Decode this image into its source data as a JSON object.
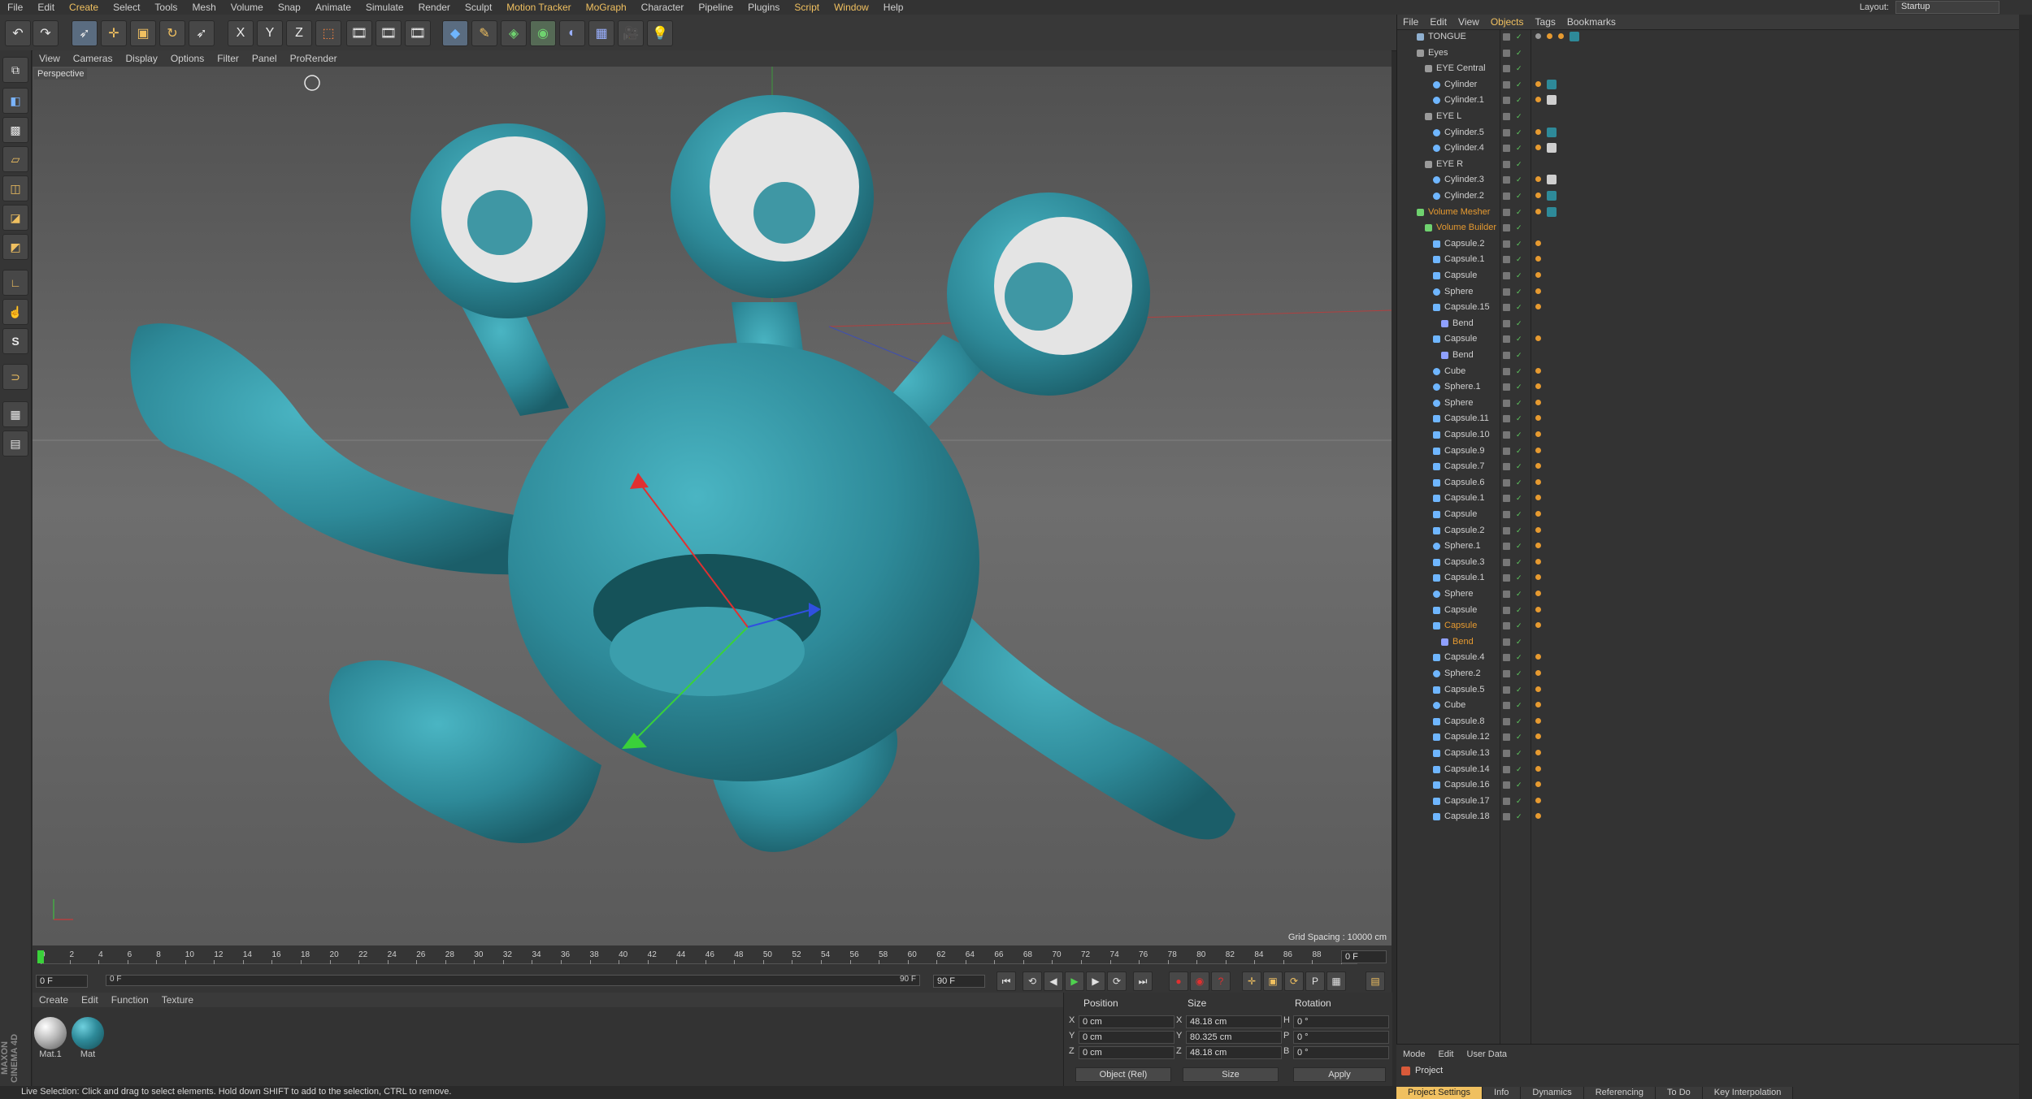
{
  "menubar": {
    "items": [
      "File",
      "Edit",
      "Create",
      "Select",
      "Tools",
      "Mesh",
      "Volume",
      "Snap",
      "Animate",
      "Simulate",
      "Render",
      "Sculpt",
      "Motion Tracker",
      "MoGraph",
      "Character",
      "Pipeline",
      "Plugins",
      "Script",
      "Window",
      "Help"
    ],
    "layout_label": "Layout:",
    "layout_value": "Startup"
  },
  "toolbar": {
    "icons": [
      "undo-icon",
      "redo-icon",
      "live-selection-icon",
      "move-icon",
      "scale-icon",
      "rotate-icon",
      "recent-tool-icon",
      "x-axis-icon",
      "y-axis-icon",
      "z-axis-icon",
      "coordinate-system-icon",
      "render-view-icon",
      "render-picture-viewer-icon",
      "edit-render-settings-icon",
      "cube-icon",
      "pen-icon",
      "subdivision-icon",
      "array-icon",
      "deformer-icon",
      "floor-icon",
      "camera-icon",
      "light-icon"
    ],
    "axis_labels": [
      "X",
      "Y",
      "Z"
    ]
  },
  "left_tools": [
    "make-editable-icon",
    "model-mode-icon",
    "texture-mode-icon",
    "workplane-icon",
    "points-mode-icon",
    "edges-mode-icon",
    "polygons-mode-icon",
    "enable-axis-icon",
    "tweak-icon",
    "solo-icon",
    "snap-icon",
    "workplane-lock-icon",
    "locked-workplane-icon"
  ],
  "viewport": {
    "menu": [
      "View",
      "Cameras",
      "Display",
      "Options",
      "Filter",
      "Panel",
      "ProRender"
    ],
    "label": "Perspective",
    "grid_spacing": "Grid Spacing : 10000 cm"
  },
  "timeline": {
    "ticks": [
      "0",
      "2",
      "4",
      "6",
      "8",
      "10",
      "12",
      "14",
      "16",
      "18",
      "20",
      "22",
      "24",
      "26",
      "28",
      "30",
      "32",
      "34",
      "36",
      "38",
      "40",
      "42",
      "44",
      "46",
      "48",
      "50",
      "52",
      "54",
      "56",
      "58",
      "60",
      "62",
      "64",
      "66",
      "68",
      "70",
      "72",
      "74",
      "76",
      "78",
      "80",
      "82",
      "84",
      "86",
      "88",
      "90"
    ],
    "current_frame": "0 F",
    "start_frame": "0 F",
    "min_frame": "0 F",
    "max_frame": "90 F",
    "end_frame": "90 F"
  },
  "material_manager": {
    "menu": [
      "Create",
      "Edit",
      "Function",
      "Texture"
    ],
    "materials": [
      {
        "name": "Mat.1",
        "color": "#b8b8b8"
      },
      {
        "name": "Mat",
        "color": "#2e8a99"
      }
    ]
  },
  "coordinates": {
    "headers": [
      "Position",
      "Size",
      "Rotation"
    ],
    "rows": [
      {
        "axis": "X",
        "pos": "0 cm",
        "size_axis": "X",
        "size": "48.18 cm",
        "rot_axis": "H",
        "rot": "0 °"
      },
      {
        "axis": "Y",
        "pos": "0 cm",
        "size_axis": "Y",
        "size": "80.325 cm",
        "rot_axis": "P",
        "rot": "0 °"
      },
      {
        "axis": "Z",
        "pos": "0 cm",
        "size_axis": "Z",
        "size": "48.18 cm",
        "rot_axis": "B",
        "rot": "0 °"
      }
    ],
    "mode_select": "Object (Rel)",
    "size_select": "Size",
    "apply_label": "Apply"
  },
  "status_text": "Live Selection: Click and drag to select elements. Hold down SHIFT to add to the selection, CTRL to remove.",
  "brand": "MAXON CINEMA 4D",
  "object_manager": {
    "menu": [
      "File",
      "Edit",
      "View",
      "Objects",
      "Tags",
      "Bookmarks"
    ],
    "objects": [
      {
        "name": "TONGUE",
        "indent": 0,
        "type": "joint",
        "tags": [
          "checker",
          "bend",
          "sphere-orange",
          "teal"
        ]
      },
      {
        "name": "Eyes",
        "indent": 0,
        "type": "null",
        "tags": []
      },
      {
        "name": "EYE Central",
        "indent": 1,
        "type": "null",
        "tags": []
      },
      {
        "name": "Cylinder",
        "indent": 2,
        "type": "cyl",
        "tags": [
          "dots",
          "teal"
        ]
      },
      {
        "name": "Cylinder.1",
        "indent": 2,
        "type": "cyl",
        "tags": [
          "dots",
          "white"
        ]
      },
      {
        "name": "EYE L",
        "indent": 1,
        "type": "null",
        "tags": []
      },
      {
        "name": "Cylinder.5",
        "indent": 2,
        "type": "cyl",
        "tags": [
          "dots",
          "teal"
        ]
      },
      {
        "name": "Cylinder.4",
        "indent": 2,
        "type": "cyl",
        "tags": [
          "dots",
          "white"
        ]
      },
      {
        "name": "EYE R",
        "indent": 1,
        "type": "null",
        "tags": []
      },
      {
        "name": "Cylinder.3",
        "indent": 2,
        "type": "cyl",
        "tags": [
          "dots",
          "white"
        ]
      },
      {
        "name": "Cylinder.2",
        "indent": 2,
        "type": "cyl",
        "tags": [
          "dots",
          "teal"
        ]
      },
      {
        "name": "Volume Mesher",
        "indent": 0,
        "type": "vol",
        "orange": true,
        "tags": [
          "dots",
          "teal"
        ]
      },
      {
        "name": "Volume Builder",
        "indent": 1,
        "type": "vol",
        "orange": true,
        "tags": []
      },
      {
        "name": "Capsule.2",
        "indent": 2,
        "type": "cap",
        "tags": [
          "dots"
        ]
      },
      {
        "name": "Capsule.1",
        "indent": 2,
        "type": "cap",
        "tags": [
          "dots"
        ]
      },
      {
        "name": "Capsule",
        "indent": 2,
        "type": "cap",
        "tags": [
          "dots"
        ]
      },
      {
        "name": "Sphere",
        "indent": 2,
        "type": "sph",
        "tags": [
          "dots"
        ]
      },
      {
        "name": "Capsule.15",
        "indent": 2,
        "type": "cap",
        "tags": [
          "dots"
        ]
      },
      {
        "name": "Bend",
        "indent": 3,
        "type": "bend",
        "tags": []
      },
      {
        "name": "Capsule",
        "indent": 2,
        "type": "cap",
        "tags": [
          "dots"
        ]
      },
      {
        "name": "Bend",
        "indent": 3,
        "type": "bend",
        "tags": []
      },
      {
        "name": "Cube",
        "indent": 2,
        "type": "sph",
        "tags": [
          "dots"
        ]
      },
      {
        "name": "Sphere.1",
        "indent": 2,
        "type": "sph",
        "tags": [
          "dots"
        ]
      },
      {
        "name": "Sphere",
        "indent": 2,
        "type": "sph",
        "tags": [
          "dots"
        ]
      },
      {
        "name": "Capsule.11",
        "indent": 2,
        "type": "cap",
        "tags": [
          "dots"
        ]
      },
      {
        "name": "Capsule.10",
        "indent": 2,
        "type": "cap",
        "tags": [
          "dots"
        ]
      },
      {
        "name": "Capsule.9",
        "indent": 2,
        "type": "cap",
        "tags": [
          "dots"
        ]
      },
      {
        "name": "Capsule.7",
        "indent": 2,
        "type": "cap",
        "tags": [
          "dots"
        ]
      },
      {
        "name": "Capsule.6",
        "indent": 2,
        "type": "cap",
        "tags": [
          "dots"
        ]
      },
      {
        "name": "Capsule.1",
        "indent": 2,
        "type": "cap",
        "tags": [
          "dots"
        ]
      },
      {
        "name": "Capsule",
        "indent": 2,
        "type": "cap",
        "tags": [
          "dots"
        ]
      },
      {
        "name": "Capsule.2",
        "indent": 2,
        "type": "cap",
        "tags": [
          "dots"
        ]
      },
      {
        "name": "Sphere.1",
        "indent": 2,
        "type": "sph",
        "tags": [
          "dots"
        ]
      },
      {
        "name": "Capsule.3",
        "indent": 2,
        "type": "cap",
        "tags": [
          "dots"
        ]
      },
      {
        "name": "Capsule.1",
        "indent": 2,
        "type": "cap",
        "tags": [
          "dots"
        ]
      },
      {
        "name": "Sphere",
        "indent": 2,
        "type": "sph",
        "tags": [
          "dots"
        ]
      },
      {
        "name": "Capsule",
        "indent": 2,
        "type": "cap",
        "tags": [
          "dots"
        ]
      },
      {
        "name": "Capsule",
        "indent": 2,
        "type": "cap",
        "orange": true,
        "tags": [
          "dots"
        ]
      },
      {
        "name": "Bend",
        "indent": 3,
        "type": "bend",
        "orange": true,
        "tags": []
      },
      {
        "name": "Capsule.4",
        "indent": 2,
        "type": "cap",
        "tags": [
          "dots"
        ]
      },
      {
        "name": "Sphere.2",
        "indent": 2,
        "type": "sph",
        "tags": [
          "dots"
        ]
      },
      {
        "name": "Capsule.5",
        "indent": 2,
        "type": "cap",
        "tags": [
          "dots"
        ]
      },
      {
        "name": "Cube",
        "indent": 2,
        "type": "sph",
        "tags": [
          "dots"
        ]
      },
      {
        "name": "Capsule.8",
        "indent": 2,
        "type": "cap",
        "tags": [
          "dots"
        ]
      },
      {
        "name": "Capsule.12",
        "indent": 2,
        "type": "cap",
        "tags": [
          "dots"
        ]
      },
      {
        "name": "Capsule.13",
        "indent": 2,
        "type": "cap",
        "tags": [
          "dots"
        ]
      },
      {
        "name": "Capsule.14",
        "indent": 2,
        "type": "cap",
        "tags": [
          "dots"
        ]
      },
      {
        "name": "Capsule.16",
        "indent": 2,
        "type": "cap",
        "tags": [
          "dots"
        ]
      },
      {
        "name": "Capsule.17",
        "indent": 2,
        "type": "cap",
        "tags": [
          "dots"
        ]
      },
      {
        "name": "Capsule.18",
        "indent": 2,
        "type": "cap",
        "tags": [
          "dots"
        ]
      }
    ]
  },
  "attribute_manager": {
    "menu": [
      "Mode",
      "Edit",
      "User Data"
    ],
    "title": "Project",
    "tabs": [
      "Project Settings",
      "Info",
      "Dynamics",
      "Referencing",
      "To Do",
      "Key Interpolation"
    ]
  },
  "colors": {
    "accent": "#f0c060",
    "monster": "#2e8a99",
    "orange": "#e69a30"
  }
}
